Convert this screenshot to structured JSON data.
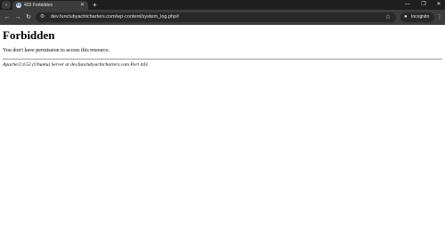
{
  "browser": {
    "tab_search_icon": "chevron-down-icon",
    "tab": {
      "favicon": "wordpress-icon",
      "favicon_glyph": "W",
      "title": "403 Forbidden",
      "close_glyph": "✕"
    },
    "new_tab_glyph": "+",
    "window_controls": {
      "minimize_glyph": "—",
      "maximize_glyph": "❐",
      "close_glyph": "✕"
    },
    "toolbar": {
      "back_glyph": "←",
      "forward_glyph": "→",
      "reload_glyph": "↻",
      "site_info_glyph": "⚙",
      "url": "dev.funclubyachtcharters.com/wp-content/system_log.php#",
      "bookmark_glyph": "☆",
      "incognito_glyph": "●",
      "incognito_label": "Incognito",
      "menu_glyph": "⋮"
    },
    "colors": {
      "tabbar": "#1f1f1f",
      "toolbar": "#3c3c3c",
      "omnibox": "#282828"
    }
  },
  "page": {
    "heading": "Forbidden",
    "message": "You don't have permission to access this resource.",
    "server_address": "Apache/2.4.52 (Ubuntu) Server at dev.funclubyachtcharters.com Port 443"
  }
}
